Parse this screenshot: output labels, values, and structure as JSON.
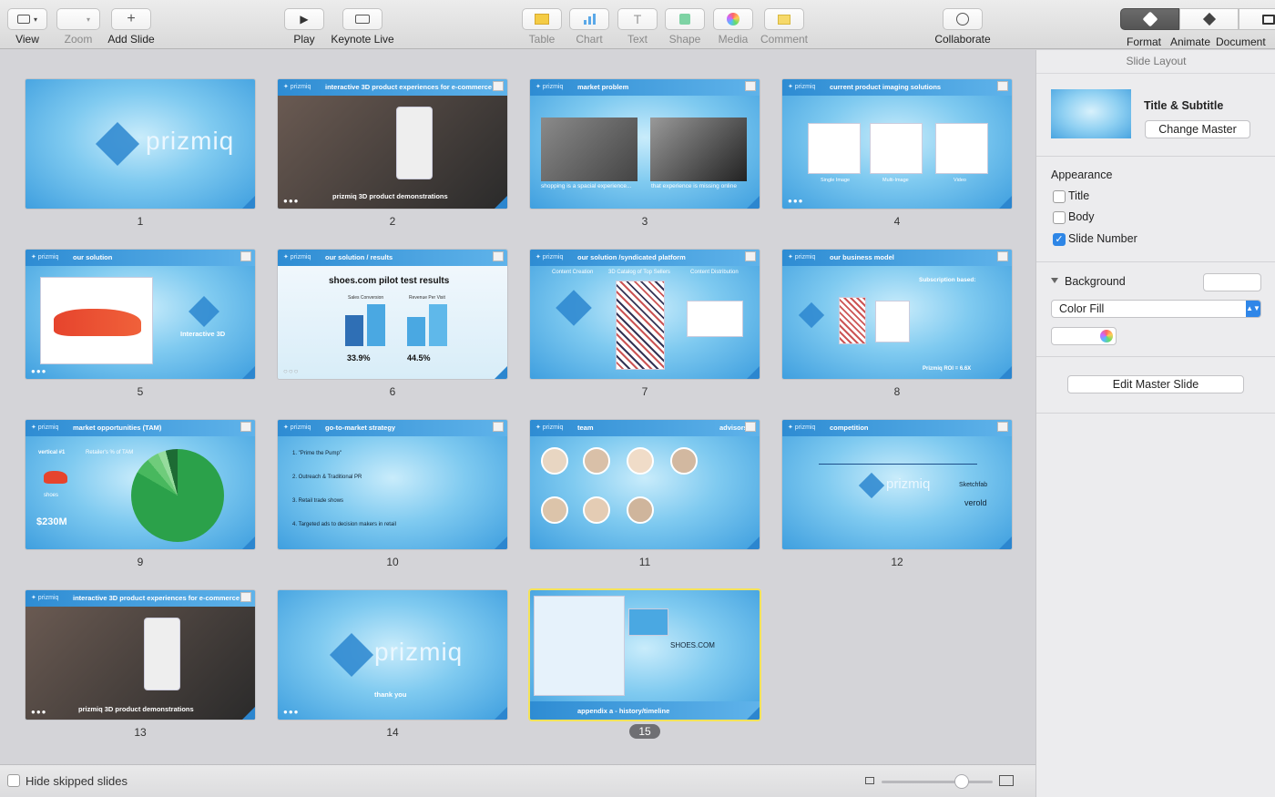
{
  "toolbar": {
    "view_label": "View",
    "zoom_label": "Zoom",
    "add_slide_label": "Add Slide",
    "play_label": "Play",
    "keynote_live_label": "Keynote Live",
    "table_label": "Table",
    "chart_label": "Chart",
    "text_label": "Text",
    "shape_label": "Shape",
    "media_label": "Media",
    "comment_label": "Comment",
    "collaborate_label": "Collaborate",
    "format_label": "Format",
    "animate_label": "Animate",
    "document_label": "Document"
  },
  "slides": [
    {
      "number": "1",
      "title": "",
      "logo_text": "prizmiq"
    },
    {
      "number": "2",
      "title": "interactive 3D product experiences for e-commerce",
      "caption": "prizmiq 3D product demonstrations"
    },
    {
      "number": "3",
      "title": "market problem",
      "caption_left": "shopping is a spacial experience...",
      "caption_right": "that experience is missing online"
    },
    {
      "number": "4",
      "title": "current product imaging solutions",
      "label_a": "Single Image",
      "label_b": "Multi-Image",
      "label_c": "Video"
    },
    {
      "number": "5",
      "title": "our solution",
      "caption": "Interactive 3D"
    },
    {
      "number": "6",
      "title": "our solution / results",
      "heading": "shoes.com pilot test results",
      "stat_left": "33.9%",
      "stat_right": "44.5%",
      "sub_left": "Sales Conversion",
      "sub_right": "Revenue Per Visit"
    },
    {
      "number": "7",
      "title": "our solution /syndicated platform",
      "col_a": "Content Creation",
      "col_b": "3D Catalog of Top Sellers",
      "col_c": "Content Distribution"
    },
    {
      "number": "8",
      "title": "our business model",
      "heading": "Subscription based:",
      "roi": "Prizmiq ROI = 6.6X"
    },
    {
      "number": "9",
      "title": "market opportunities (TAM)",
      "left_label": "vertical #1",
      "chart_label": "Retailer's % of TAM",
      "shoes": "shoes",
      "amount": "$230M"
    },
    {
      "number": "10",
      "title": "go-to-market strategy",
      "line1": "1. \"Prime the Pump\"",
      "line2": "2. Outreach & Traditional PR",
      "line3": "3. Retail trade shows",
      "line4": "4. Targeted ads to decision makers in retail"
    },
    {
      "number": "11",
      "title": "team",
      "right_title": "advisors"
    },
    {
      "number": "12",
      "title": "competition",
      "brand_a": "prizmiq",
      "brand_b": "Sketchfab",
      "brand_c": "verold"
    },
    {
      "number": "13",
      "title": "interactive 3D product experiences for e-commerce",
      "caption": "prizmiq 3D product demonstrations"
    },
    {
      "number": "14",
      "title": "",
      "logo_text": "prizmiq",
      "caption": "thank you"
    },
    {
      "number": "15",
      "title": "appendix a - history/timeline",
      "shoes": "SHOES.COM"
    }
  ],
  "bottom": {
    "hide_skipped_label": "Hide skipped slides"
  },
  "inspector": {
    "panel_title": "Slide Layout",
    "master_name": "Title & Subtitle",
    "change_master_label": "Change Master",
    "appearance_label": "Appearance",
    "title_option": "Title",
    "body_option": "Body",
    "slide_number_option": "Slide Number",
    "background_label": "Background",
    "fill_type": "Color Fill",
    "edit_master_label": "Edit Master Slide"
  }
}
